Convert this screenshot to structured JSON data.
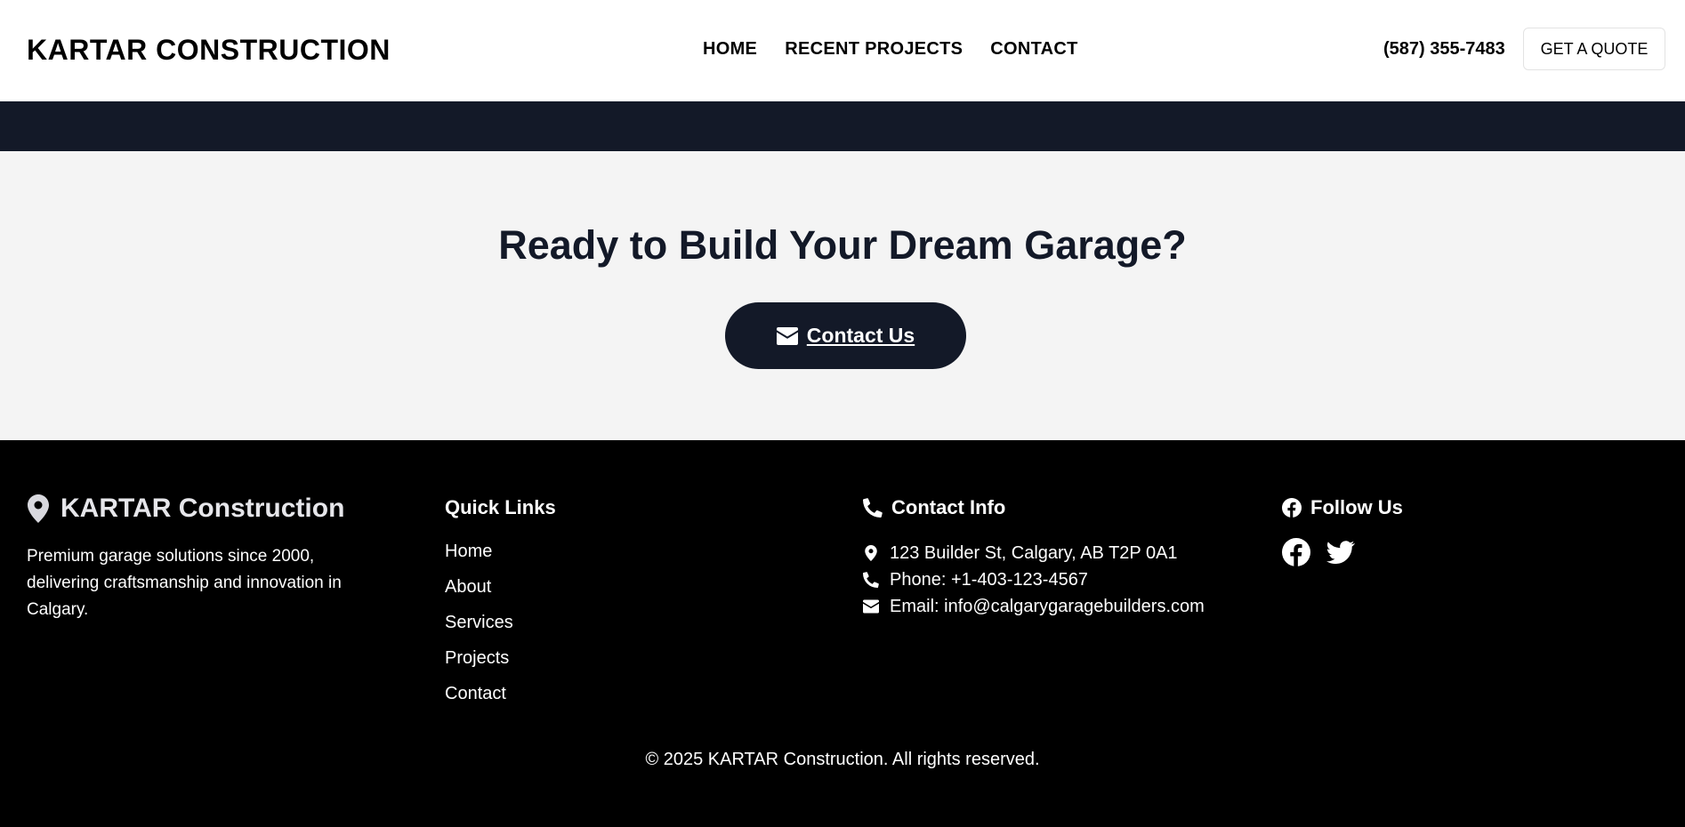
{
  "header": {
    "brand": "KARTAR CONSTRUCTION",
    "nav": [
      "HOME",
      "RECENT PROJECTS",
      "CONTACT"
    ],
    "phone": "(587) 355-7483",
    "quote_label": "GET A QUOTE"
  },
  "cta": {
    "title": "Ready to Build Your Dream Garage?",
    "button_label": "Contact Us",
    "button_icon": "envelope-icon"
  },
  "footer": {
    "brand": "KARTAR Construction",
    "brand_icon": "map-marker-icon",
    "description": "Premium garage solutions since 2000, delivering craftsmanship and innovation in Calgary.",
    "quick_links": {
      "title": "Quick Links",
      "items": [
        "Home",
        "About",
        "Services",
        "Projects",
        "Contact"
      ]
    },
    "contact": {
      "title": "Contact Info",
      "title_icon": "phone-icon",
      "address": "123 Builder St, Calgary, AB T2P 0A1",
      "phone": "Phone: +1-403-123-4567",
      "email": "Email: info@calgarygaragebuilders.com"
    },
    "follow": {
      "title": "Follow Us",
      "title_icon": "facebook-icon",
      "icons": [
        "facebook-icon",
        "twitter-icon"
      ]
    },
    "copyright": "© 2025 KARTAR Construction. All rights reserved."
  },
  "colors": {
    "navy": "#131928",
    "cta_bg": "#f4f4f4",
    "footer_bg": "#000000"
  }
}
